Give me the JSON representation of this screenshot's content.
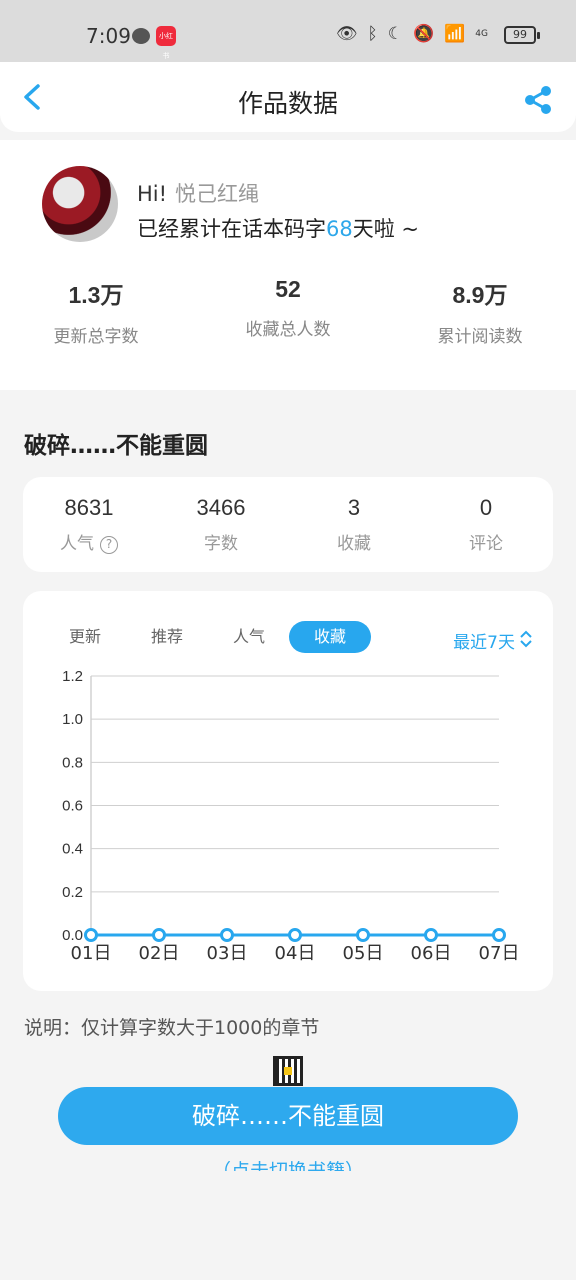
{
  "status_bar": {
    "time": "7:09",
    "battery": "99",
    "red_app_label": "小红书",
    "icons": [
      "eye-icon",
      "bluetooth-icon",
      "moon-icon",
      "mute-bell-icon",
      "wifi-icon",
      "signal-icon"
    ],
    "network": "4G"
  },
  "header": {
    "title": "作品数据"
  },
  "profile": {
    "greeting": "Hi!",
    "nickname": "悦己红绳",
    "days_prefix": "已经累计在话本码字",
    "days": "68",
    "days_suffix": "天啦 ~",
    "stats": [
      {
        "value": "1.3万",
        "label": "更新总字数"
      },
      {
        "value": "52",
        "label": "收藏总人数"
      },
      {
        "value": "8.9万",
        "label": "累计阅读数"
      }
    ]
  },
  "book": {
    "title": "破碎……不能重圆",
    "stats": [
      {
        "value": "8631",
        "label": "人气"
      },
      {
        "value": "3466",
        "label": "字数"
      },
      {
        "value": "3",
        "label": "收藏"
      },
      {
        "value": "0",
        "label": "评论"
      }
    ]
  },
  "chart_tabs": [
    "更新",
    "推荐",
    "人气",
    "收藏"
  ],
  "active_tab": "收藏",
  "range_label": "最近7天",
  "chart_data": {
    "type": "line",
    "categories": [
      "01日",
      "02日",
      "03日",
      "04日",
      "05日",
      "06日",
      "07日"
    ],
    "values": [
      0,
      0,
      0,
      0,
      0,
      0,
      0
    ],
    "ylim": [
      0,
      1.2
    ],
    "yticks": [
      "0.0",
      "0.2",
      "0.4",
      "0.6",
      "0.8",
      "1.0",
      "1.2"
    ],
    "grid": true,
    "color": "#28a7ee"
  },
  "note": "说明：仅计算字数大于1000的章节",
  "switch_button": "破碎……不能重圆",
  "switch_hint": "（点击切换书籍）",
  "colors": {
    "accent": "#28a7ee"
  }
}
